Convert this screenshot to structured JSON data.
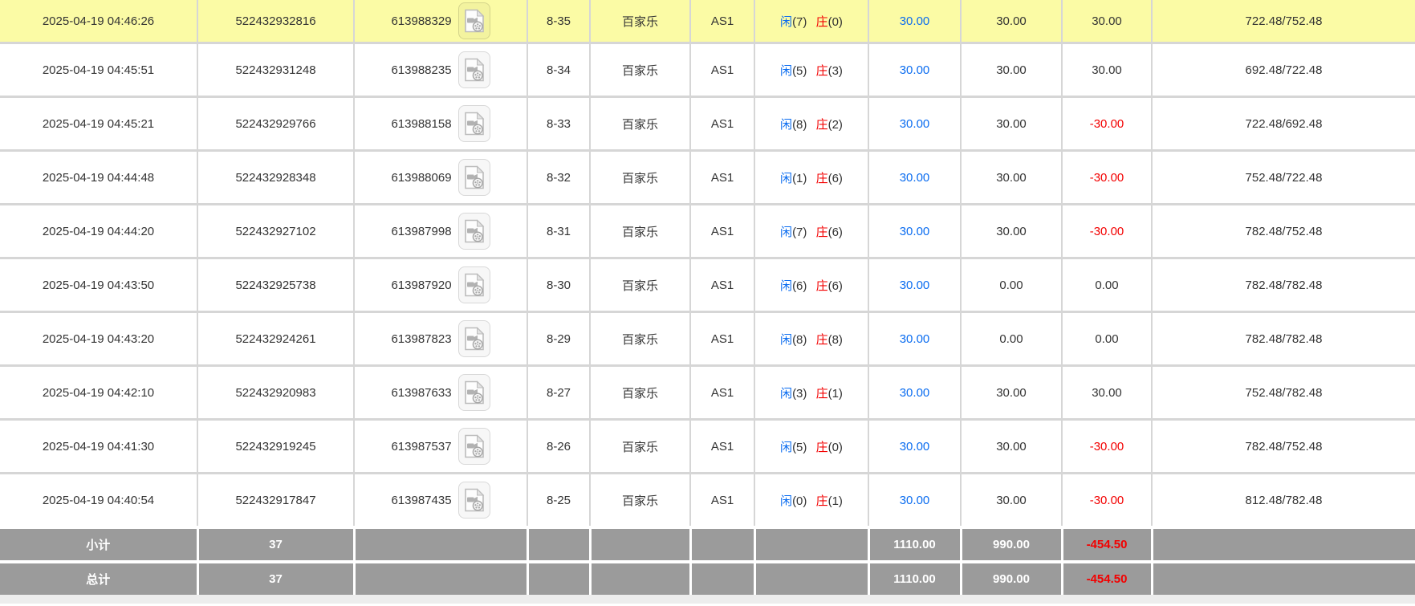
{
  "colors": {
    "highlight_row": "#fbfba5",
    "summary_bg": "#9b9b9b",
    "grid_line": "#d6d6d6",
    "link_blue": "#0a6cf0",
    "negative_red": "#f30000",
    "text": "#333333"
  },
  "table": {
    "labels": {
      "player": "闲",
      "banker": "庄"
    },
    "icons": {
      "video": "video-file-icon"
    },
    "rows": [
      {
        "time": "2025-04-19 04:46:26",
        "bet_id": "522432932816",
        "round_id": "613988329",
        "shoe_round": "8-35",
        "game": "百家乐",
        "table_name": "AS1",
        "result": {
          "player": 7,
          "banker": 0
        },
        "bet": "30.00",
        "valid": "30.00",
        "win_loss": "30.00",
        "balance": "722.48/752.48",
        "highlighted": true
      },
      {
        "time": "2025-04-19 04:45:51",
        "bet_id": "522432931248",
        "round_id": "613988235",
        "shoe_round": "8-34",
        "game": "百家乐",
        "table_name": "AS1",
        "result": {
          "player": 5,
          "banker": 3
        },
        "bet": "30.00",
        "valid": "30.00",
        "win_loss": "30.00",
        "balance": "692.48/722.48",
        "highlighted": false
      },
      {
        "time": "2025-04-19 04:45:21",
        "bet_id": "522432929766",
        "round_id": "613988158",
        "shoe_round": "8-33",
        "game": "百家乐",
        "table_name": "AS1",
        "result": {
          "player": 8,
          "banker": 2
        },
        "bet": "30.00",
        "valid": "30.00",
        "win_loss": "-30.00",
        "balance": "722.48/692.48",
        "highlighted": false
      },
      {
        "time": "2025-04-19 04:44:48",
        "bet_id": "522432928348",
        "round_id": "613988069",
        "shoe_round": "8-32",
        "game": "百家乐",
        "table_name": "AS1",
        "result": {
          "player": 1,
          "banker": 6
        },
        "bet": "30.00",
        "valid": "30.00",
        "win_loss": "-30.00",
        "balance": "752.48/722.48",
        "highlighted": false
      },
      {
        "time": "2025-04-19 04:44:20",
        "bet_id": "522432927102",
        "round_id": "613987998",
        "shoe_round": "8-31",
        "game": "百家乐",
        "table_name": "AS1",
        "result": {
          "player": 7,
          "banker": 6
        },
        "bet": "30.00",
        "valid": "30.00",
        "win_loss": "-30.00",
        "balance": "782.48/752.48",
        "highlighted": false
      },
      {
        "time": "2025-04-19 04:43:50",
        "bet_id": "522432925738",
        "round_id": "613987920",
        "shoe_round": "8-30",
        "game": "百家乐",
        "table_name": "AS1",
        "result": {
          "player": 6,
          "banker": 6
        },
        "bet": "30.00",
        "valid": "0.00",
        "win_loss": "0.00",
        "balance": "782.48/782.48",
        "highlighted": false
      },
      {
        "time": "2025-04-19 04:43:20",
        "bet_id": "522432924261",
        "round_id": "613987823",
        "shoe_round": "8-29",
        "game": "百家乐",
        "table_name": "AS1",
        "result": {
          "player": 8,
          "banker": 8
        },
        "bet": "30.00",
        "valid": "0.00",
        "win_loss": "0.00",
        "balance": "782.48/782.48",
        "highlighted": false
      },
      {
        "time": "2025-04-19 04:42:10",
        "bet_id": "522432920983",
        "round_id": "613987633",
        "shoe_round": "8-27",
        "game": "百家乐",
        "table_name": "AS1",
        "result": {
          "player": 3,
          "banker": 1
        },
        "bet": "30.00",
        "valid": "30.00",
        "win_loss": "30.00",
        "balance": "752.48/782.48",
        "highlighted": false
      },
      {
        "time": "2025-04-19 04:41:30",
        "bet_id": "522432919245",
        "round_id": "613987537",
        "shoe_round": "8-26",
        "game": "百家乐",
        "table_name": "AS1",
        "result": {
          "player": 5,
          "banker": 0
        },
        "bet": "30.00",
        "valid": "30.00",
        "win_loss": "-30.00",
        "balance": "782.48/752.48",
        "highlighted": false
      },
      {
        "time": "2025-04-19 04:40:54",
        "bet_id": "522432917847",
        "round_id": "613987435",
        "shoe_round": "8-25",
        "game": "百家乐",
        "table_name": "AS1",
        "result": {
          "player": 0,
          "banker": 1
        },
        "bet": "30.00",
        "valid": "30.00",
        "win_loss": "-30.00",
        "balance": "812.48/782.48",
        "highlighted": false
      }
    ],
    "summary_rows": [
      {
        "label": "小计",
        "count": "37",
        "bet": "1110.00",
        "valid": "990.00",
        "win_loss": "-454.50"
      },
      {
        "label": "总计",
        "count": "37",
        "bet": "1110.00",
        "valid": "990.00",
        "win_loss": "-454.50"
      }
    ]
  }
}
